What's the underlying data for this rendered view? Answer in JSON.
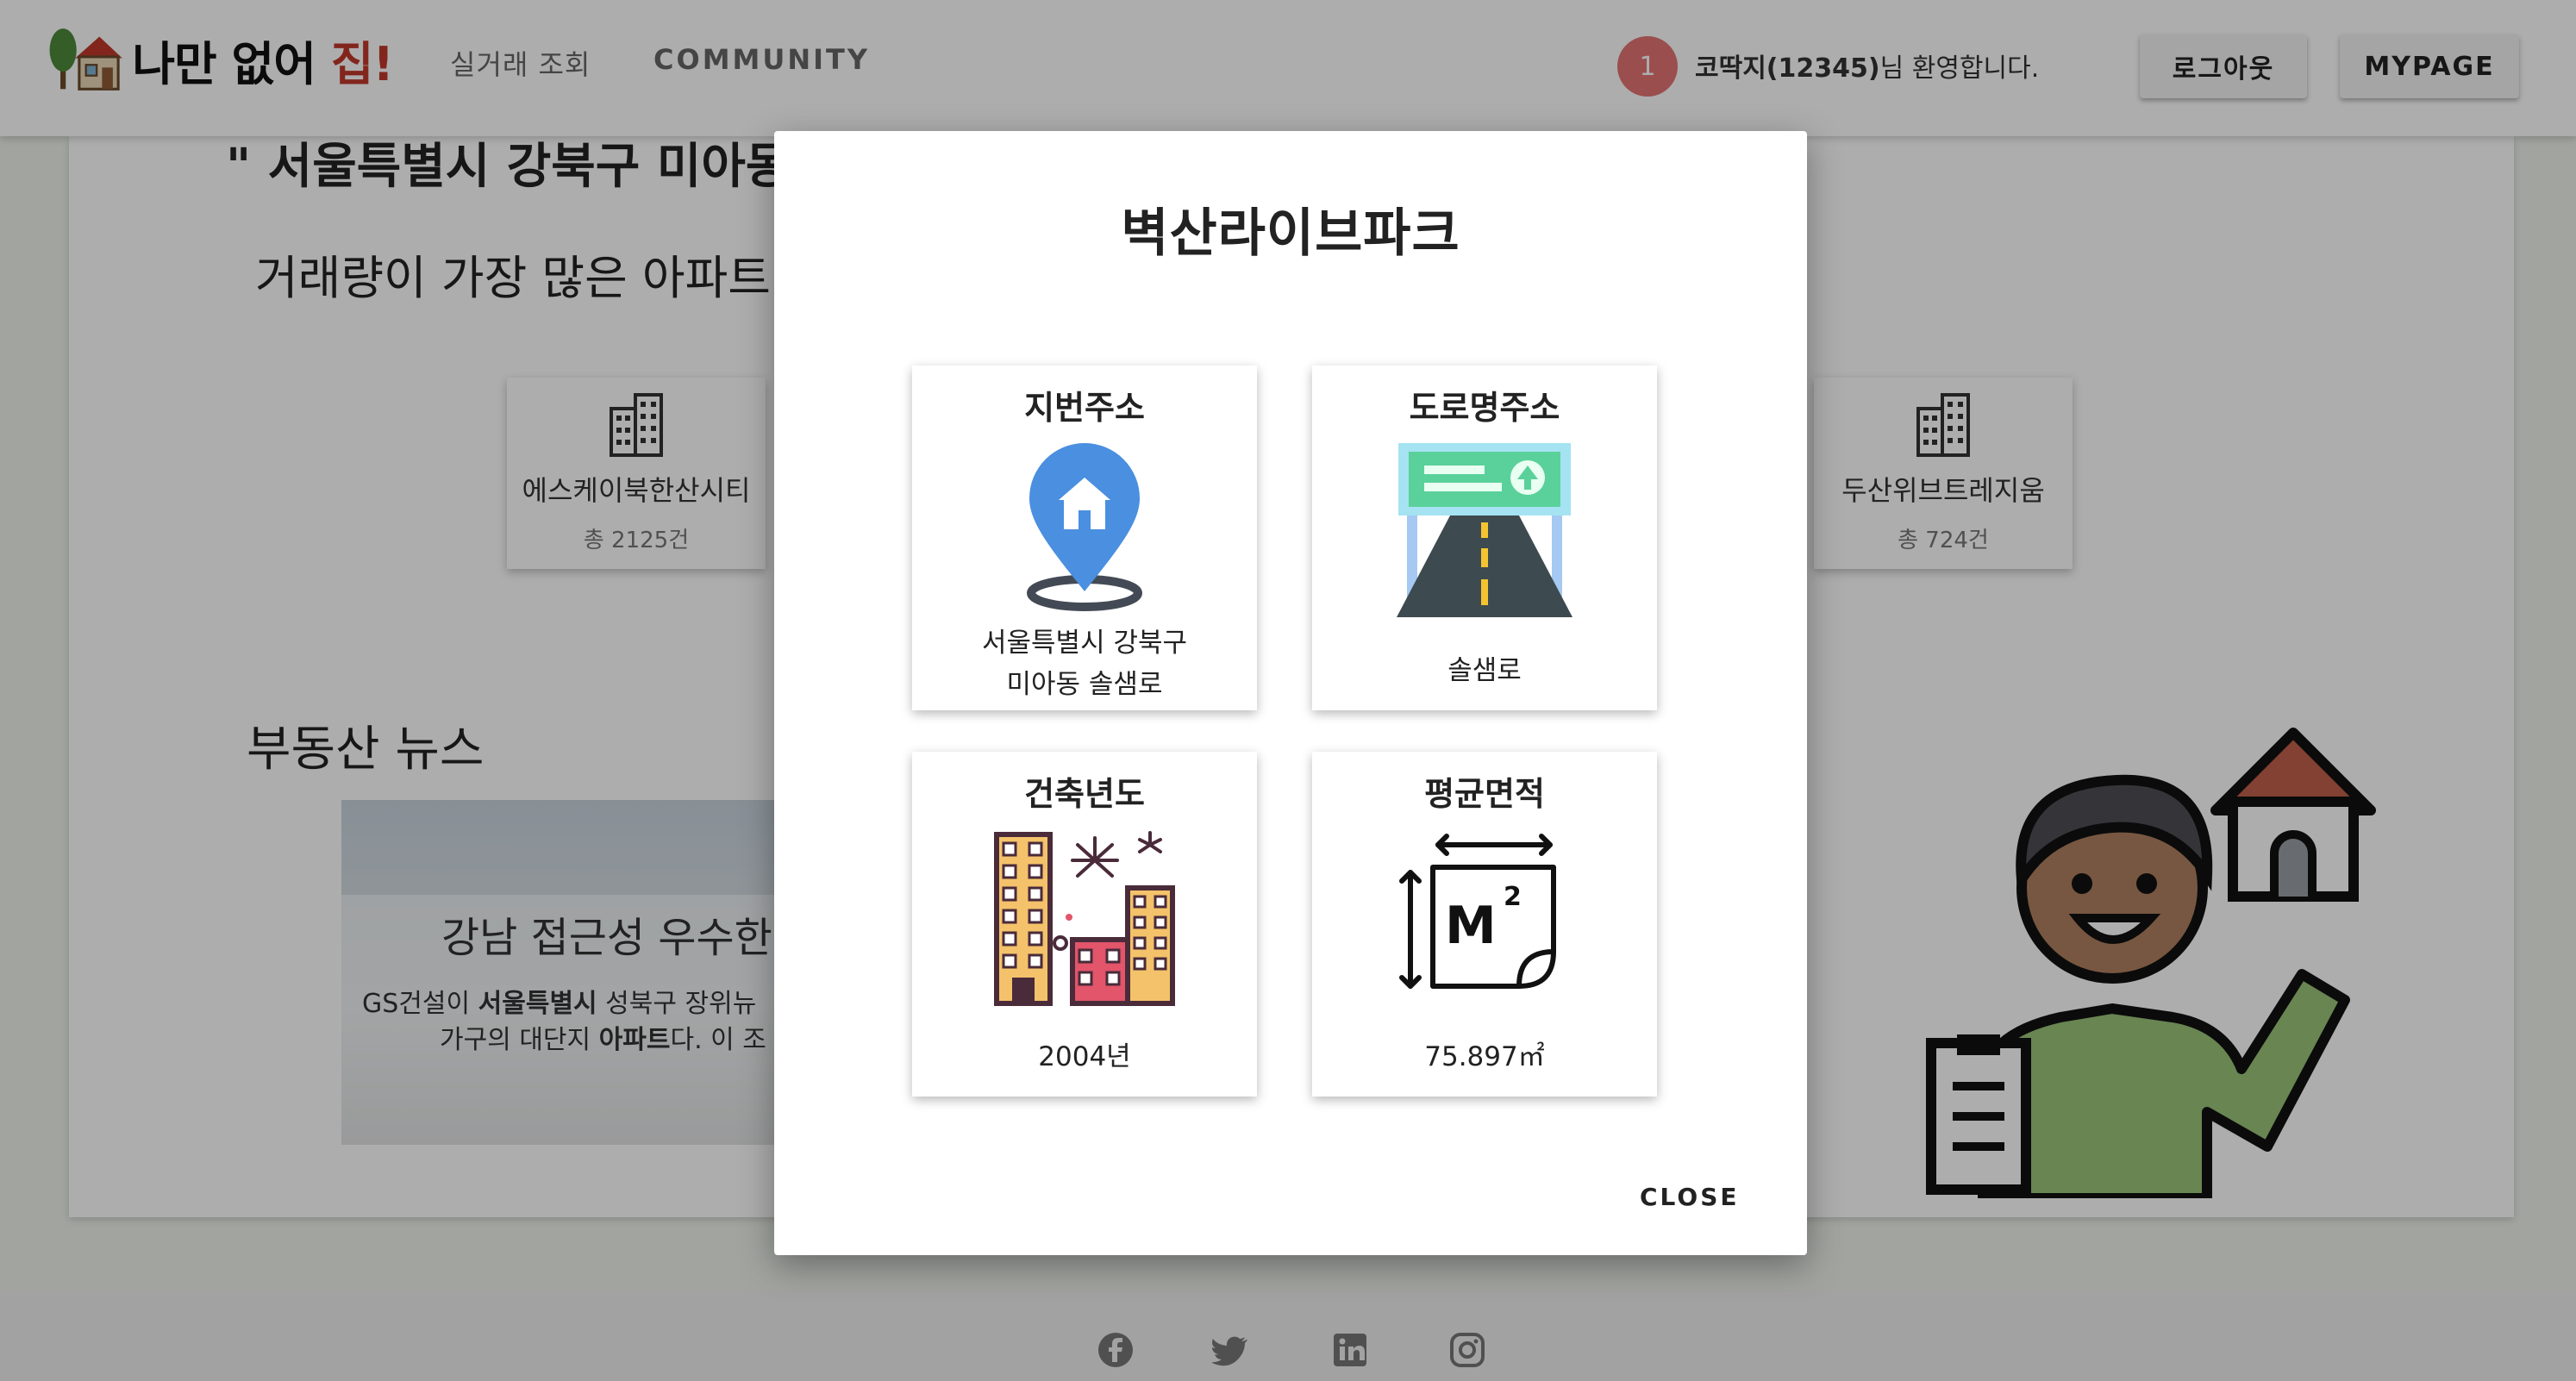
{
  "header": {
    "logo_text": "나만 없어 ",
    "logo_accent": "집!",
    "nav": [
      "실거래 조회",
      "COMMUNITY"
    ],
    "notification_count": "1",
    "user_name": "코딱지(12345)",
    "welcome_suffix": "님 환영합니다.",
    "logout_label": "로그아웃",
    "mypage_label": "MYPAGE"
  },
  "main": {
    "location_title": "\"  서울특별시 강북구 미아동",
    "most_traded_title": "거래량이 가장 많은 아파트",
    "apartments": [
      {
        "name": "에스케이북한산시티",
        "count": "총 2125건"
      },
      {
        "name": "두산위브트레지움",
        "count": "총 724건"
      }
    ],
    "news_title": "부동산 뉴스",
    "news": {
      "headline": "강남 접근성 우수한",
      "body_line1_a": "GS건설이 ",
      "body_line1_b": "서울특별시",
      "body_line1_c": " 성북구 장위뉴",
      "body_line2_a": "가구의 대단지 ",
      "body_line2_b": "아파트",
      "body_line2_c": "다. 이 조"
    }
  },
  "modal": {
    "title": "벽산라이브파크",
    "tiles": [
      {
        "label": "지번주소",
        "value_line1": "서울특별시 강북구",
        "value_line2": "미아동 솔샘로"
      },
      {
        "label": "도로명주소",
        "value": "솔샘로"
      },
      {
        "label": "건축년도",
        "value": "2004년"
      },
      {
        "label": "평균면적",
        "value": "75.897㎡"
      }
    ],
    "icons": [
      "location-pin-house-icon",
      "road-sign-icon",
      "city-buildings-fireworks-icon",
      "area-square-meter-icon"
    ],
    "close_label": "CLOSE"
  },
  "colors": {
    "accent": "#c0392b",
    "pin_blue": "#4a8fe0",
    "road_green": "#5ad19a"
  }
}
